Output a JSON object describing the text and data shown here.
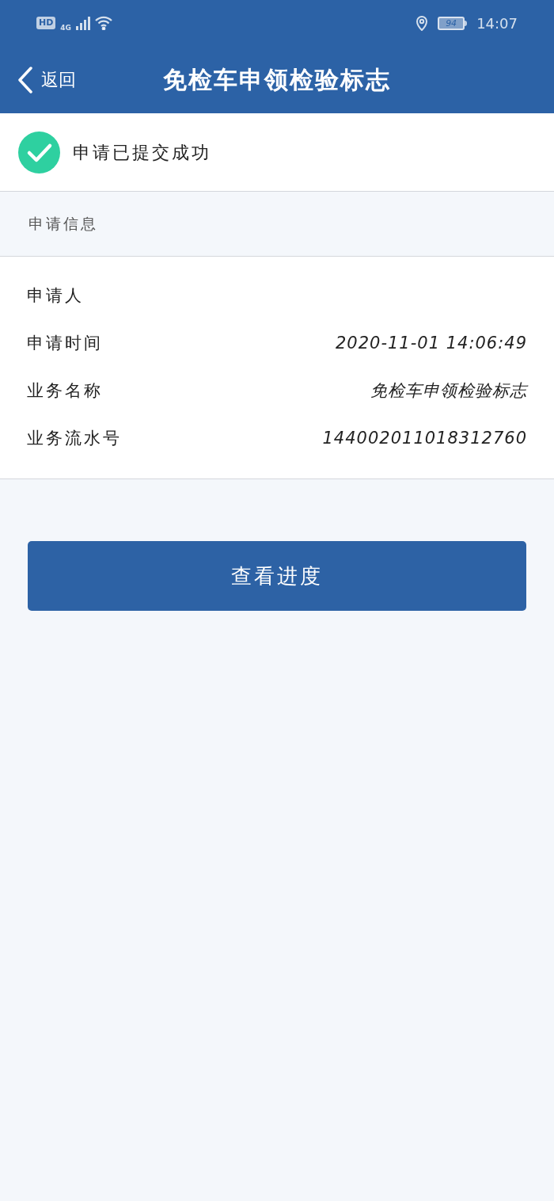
{
  "status_bar": {
    "hd": "HD",
    "network": "4G",
    "battery": "94",
    "time": "14:07"
  },
  "header": {
    "back": "返回",
    "title": "免检车申领检验标志"
  },
  "result": {
    "message": "申请已提交成功"
  },
  "section": {
    "title": "申请信息"
  },
  "fields": [
    {
      "label": "申请人"
    },
    {
      "label": "申请时间",
      "value": "2020-11-01 14:06:49"
    },
    {
      "label": "业务名称",
      "value": "免检车申领检验标志"
    },
    {
      "label": "业务流水号",
      "value": "144002011018312760"
    }
  ],
  "button": {
    "label": "查看进度"
  }
}
